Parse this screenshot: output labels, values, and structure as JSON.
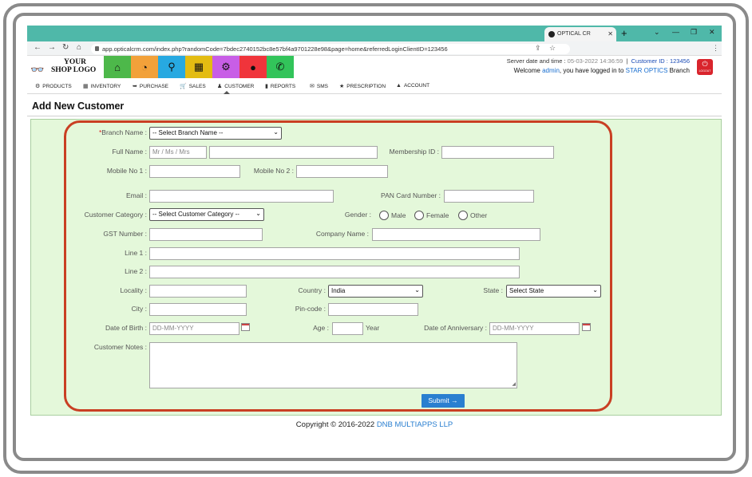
{
  "browser": {
    "tab_title": "OPTICAL CR",
    "url": "app.opticalcrm.com/index.php?randomCode=7bdec2740152bc8e57bf4a9701228e98&page=home&referredLoginClientID=123456"
  },
  "header": {
    "logo_line1": "YOUR",
    "logo_line2": "SHOP LOGO",
    "server_label": "Server date and time :",
    "server_datetime": "05-03-2022 14:36:59",
    "customer_id_label": "Customer ID :",
    "customer_id": "123456",
    "welcome": "Welcome",
    "user": "admin",
    "logged_in_text": ", you have logged in to",
    "branch_name": "STAR OPTICS",
    "branch_word": "Branch",
    "logout_label": "LOGOUT",
    "tiles": [
      {
        "icon": "home-icon",
        "color": "#4db84a"
      },
      {
        "icon": "dashboard-icon",
        "color": "#f2a13a"
      },
      {
        "icon": "search-icon",
        "color": "#27a9e1"
      },
      {
        "icon": "grid-icon",
        "color": "#e3bc12"
      },
      {
        "icon": "gear-icon",
        "color": "#c85ee6"
      },
      {
        "icon": "user-icon",
        "color": "#f0343b"
      },
      {
        "icon": "whatsapp-icon",
        "color": "#32c45a"
      }
    ]
  },
  "nav": {
    "products": "PRODUCTS",
    "inventory": "INVENTORY",
    "purchase": "PURCHASE",
    "sales": "SALES",
    "customer": "CUSTOMER",
    "reports": "REPORTS",
    "sms": "SMS",
    "prescription": "PRESCRIPTION",
    "account": "ACCOUNT"
  },
  "page_title": "Add New Customer",
  "form": {
    "branch_label": "Branch Name :",
    "branch_select": "-- Select Branch Name --",
    "fullname_label": "Full Name :",
    "title_placeholder": "Mr / Ms / Mrs",
    "membership_label": "Membership ID :",
    "mobile1_label": "Mobile No 1 :",
    "mobile2_label": "Mobile No 2 :",
    "email_label": "Email :",
    "pan_label": "PAN Card Number :",
    "category_label": "Customer Category :",
    "category_select": "-- Select Customer Category --",
    "gender_label": "Gender :",
    "gender_male": "Male",
    "gender_female": "Female",
    "gender_other": "Other",
    "gst_label": "GST Number :",
    "company_label": "Company Name :",
    "line1_label": "Line 1 :",
    "line2_label": "Line 2 :",
    "locality_label": "Locality :",
    "country_label": "Country :",
    "country_value": "India",
    "state_label": "State :",
    "state_select": "Select State",
    "city_label": "City :",
    "pincode_label": "Pin-code :",
    "dob_label": "Date of Birth :",
    "dob_placeholder": "DD-MM-YYYY",
    "age_label": "Age :",
    "age_unit": "Year",
    "anniv_label": "Date of Anniversary :",
    "anniv_placeholder": "DD-MM-YYYY",
    "notes_label": "Customer Notes :",
    "submit_label": "Submit"
  },
  "footer": {
    "copyright": "Copyright © 2016-2022",
    "brand": "DNB MULTIAPPS LLP"
  }
}
